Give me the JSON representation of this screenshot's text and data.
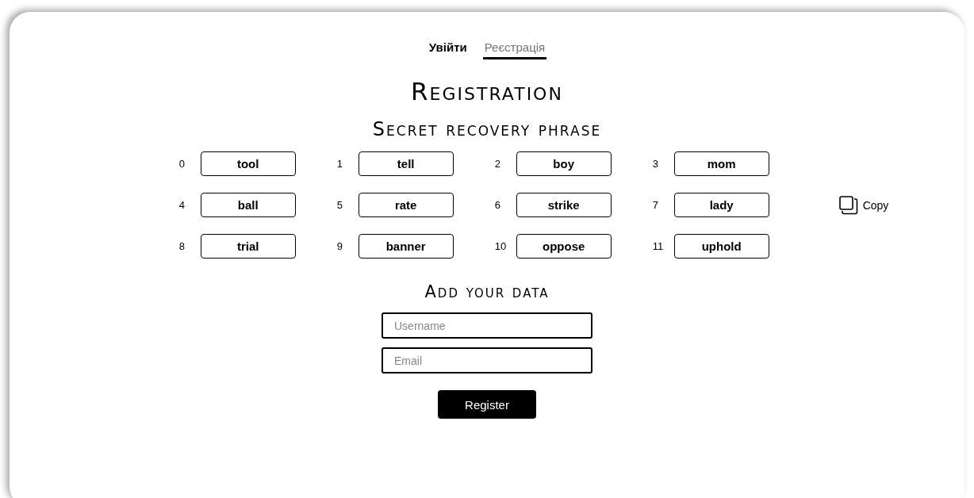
{
  "tabs": [
    {
      "label": "Увійти",
      "selected": false
    },
    {
      "label": "Реєстрація",
      "selected": true
    }
  ],
  "title": "Registration",
  "phrase": {
    "heading": "Secret recovery phrase",
    "words": [
      {
        "index": "0",
        "word": "tool"
      },
      {
        "index": "1",
        "word": "tell"
      },
      {
        "index": "2",
        "word": "boy"
      },
      {
        "index": "3",
        "word": "mom"
      },
      {
        "index": "4",
        "word": "ball"
      },
      {
        "index": "5",
        "word": "rate"
      },
      {
        "index": "6",
        "word": "strike"
      },
      {
        "index": "7",
        "word": "lady"
      },
      {
        "index": "8",
        "word": "trial"
      },
      {
        "index": "9",
        "word": "banner"
      },
      {
        "index": "10",
        "word": "oppose"
      },
      {
        "index": "11",
        "word": "uphold"
      }
    ],
    "copy_label": "Copy"
  },
  "form": {
    "heading": "Add your data",
    "fields": [
      {
        "placeholder": "Username"
      },
      {
        "placeholder": "Email"
      }
    ],
    "submit": "Register"
  }
}
